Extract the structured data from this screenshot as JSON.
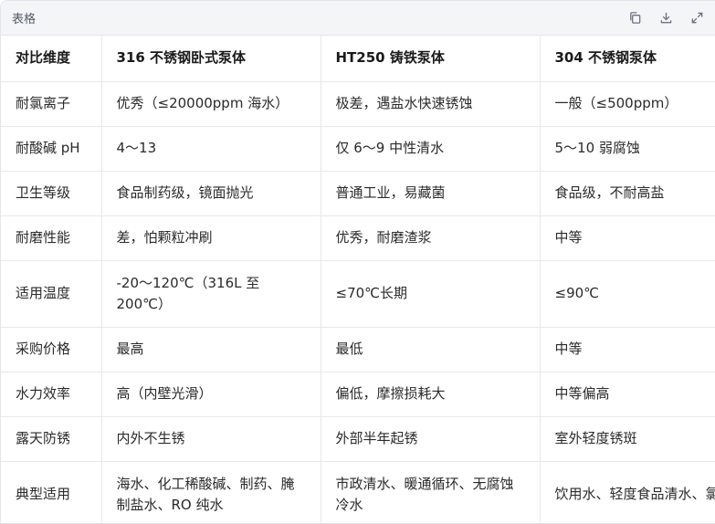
{
  "header": {
    "title": "表格"
  },
  "toolbar": {
    "copy_icon": "copy-icon",
    "download_icon": "download-icon",
    "expand_icon": "expand-icon"
  },
  "table": {
    "columns": [
      "对比维度",
      "316 不锈钢卧式泵体",
      "HT250 铸铁泵体",
      "304 不锈钢泵体"
    ],
    "rows": [
      [
        "耐氯离子",
        "优秀（≤20000ppm 海水）",
        "极差，遇盐水快速锈蚀",
        "一般（≤500ppm）"
      ],
      [
        "耐酸碱 pH",
        "4～13",
        "仅 6～9 中性清水",
        "5～10 弱腐蚀"
      ],
      [
        "卫生等级",
        "食品制药级，镜面抛光",
        "普通工业，易藏菌",
        "食品级，不耐高盐"
      ],
      [
        "耐磨性能",
        "差，怕颗粒冲刷",
        "优秀，耐磨渣浆",
        "中等"
      ],
      [
        "适用温度",
        "-20～120℃（316L 至 200℃）",
        "≤70℃长期",
        "≤90℃"
      ],
      [
        "采购价格",
        "最高",
        "最低",
        "中等"
      ],
      [
        "水力效率",
        "高（内壁光滑）",
        "偏低，摩擦损耗大",
        "中等偏高"
      ],
      [
        "露天防锈",
        "内外不生锈",
        "外部半年起锈",
        "室外轻度锈斑"
      ],
      [
        "典型适用",
        "海水、化工稀酸碱、制药、腌制盐水、RO 纯水",
        "市政清水、暖通循环、无腐蚀冷水",
        "饮用水、轻度食品清水、氯循环水"
      ]
    ]
  }
}
